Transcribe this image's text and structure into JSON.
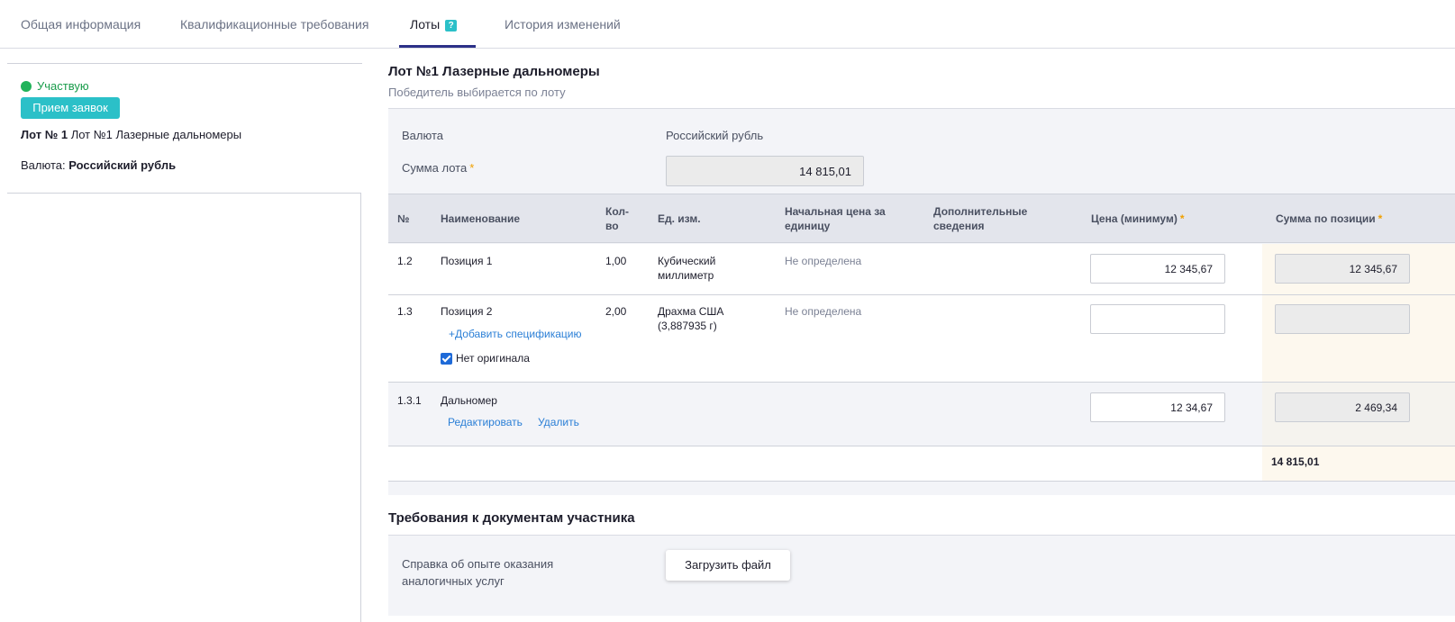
{
  "tabs": [
    {
      "label": "Общая информация"
    },
    {
      "label": "Квалификационные требования"
    },
    {
      "label": "Лоты",
      "badge": "?"
    },
    {
      "label": "История изменений"
    }
  ],
  "sidebar": {
    "status": "Участвую",
    "stage_button": "Прием заявок",
    "lot_prefix": "Лот № 1",
    "lot_name": "Лот №1 Лазерные дальномеры",
    "currency_label": "Валюта:",
    "currency_value": "Российский рубль"
  },
  "lot": {
    "title": "Лот №1 Лазерные дальномеры",
    "subtitle": "Победитель выбирается по лоту",
    "currency_label": "Валюта",
    "currency_value": "Российский рубль",
    "sum_label": "Сумма лота",
    "sum_value": "14 815,01"
  },
  "table": {
    "headers": {
      "num": "№",
      "name": "Наименование",
      "qty_1": "Кол-",
      "qty_2": "во",
      "unit": "Ед. изм.",
      "start_price_1": "Начальная цена за",
      "start_price_2": "единицу",
      "extra_1": "Дополнительные",
      "extra_2": "сведения",
      "price_min": "Цена (минимум)",
      "sum": "Сумма по позиции"
    },
    "rows": [
      {
        "num": "1.2",
        "name": "Позиция 1",
        "qty": "1,00",
        "unit_1": "Кубический",
        "unit_2": "миллиметр",
        "start_price": "Не определена",
        "price": "12 345,67",
        "sum": "12 345,67"
      },
      {
        "num": "1.3",
        "name": "Позиция 2",
        "qty": "2,00",
        "unit_1": "Драхма США",
        "unit_2": "(3,887935 г)",
        "start_price": "Не определена",
        "price": "",
        "sum": "",
        "add_spec": "+Добавить спецификацию",
        "checkbox_label": "Нет оригинала"
      },
      {
        "num": "1.3.1",
        "name": "Дальномер",
        "price": "12 34,67",
        "sum": "2 469,34",
        "edit": "Редактировать",
        "delete": "Удалить"
      }
    ],
    "total": "14 815,01"
  },
  "requirements": {
    "title": "Требования к документам участника",
    "doc_label_1": "Справка об опыте оказания",
    "doc_label_2": "аналогичных услуг",
    "upload_button": "Загрузить файл"
  },
  "colors": {
    "accent_teal": "#2bc0c8",
    "active_tab": "#2c3088",
    "status_green": "#21b35a",
    "link_blue": "#2b7fd6",
    "required_star": "#f0a000"
  }
}
